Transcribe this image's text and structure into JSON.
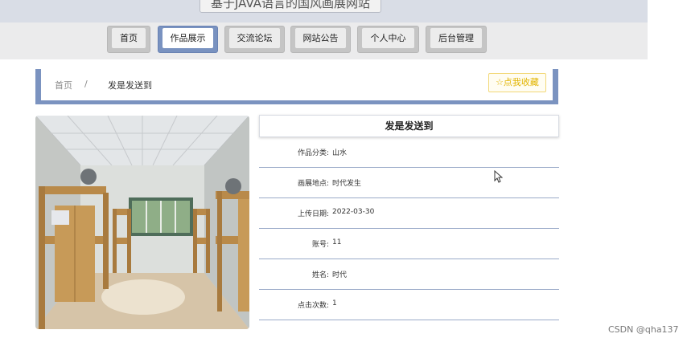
{
  "header": {
    "site_title": "基于JAVA语言的国风画展网站"
  },
  "nav": {
    "items": [
      {
        "label": "首页"
      },
      {
        "label": "作品展示",
        "active": true
      },
      {
        "label": "交流论坛"
      },
      {
        "label": "网站公告"
      },
      {
        "label": "个人中心"
      },
      {
        "label": "后台管理"
      }
    ]
  },
  "breadcrumb": {
    "home": "首页",
    "separator": "/",
    "current": "发是发送到"
  },
  "favorite_button": {
    "label": "☆点我收藏"
  },
  "detail": {
    "title": "发是发送到",
    "rows": [
      {
        "label": "作品分类:",
        "value": "山水"
      },
      {
        "label": "画展地点:",
        "value": "时代发生"
      },
      {
        "label": "上传日期:",
        "value": "2022-03-30"
      },
      {
        "label": "账号:",
        "value": "11"
      },
      {
        "label": "姓名:",
        "value": "时代"
      },
      {
        "label": "点击次数:",
        "value": "1"
      }
    ]
  },
  "watermark": "CSDN @qha137",
  "colors": {
    "accent": "#7b93c0",
    "nav_button": "#c5c5c5",
    "favorite": "#e2b400"
  }
}
